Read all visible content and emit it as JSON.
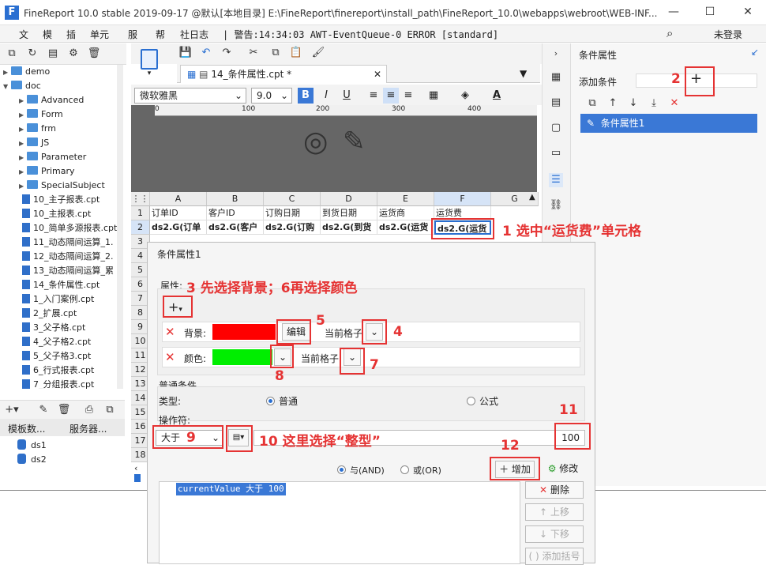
{
  "window": {
    "title": "FineReport 10.0 stable 2019-09-17 @默认[本地目录]   E:\\FineReport\\finereport\\install_path\\FineReport_10.0\\webapps\\webroot\\WEB-INF...",
    "min": "—",
    "max": "☐",
    "close": "✕"
  },
  "menu": {
    "items": [
      "文",
      "模",
      "插",
      "单元",
      "服",
      "帮",
      "社日志"
    ],
    "status": "| 警告:14:34:03 AWT-EventQueue-0 ERROR [standard]",
    "login": "未登录"
  },
  "tree": {
    "folders": [
      {
        "label": "demo"
      },
      {
        "label": "doc"
      },
      {
        "label": "Advanced"
      },
      {
        "label": "Form"
      },
      {
        "label": "frm"
      },
      {
        "label": "JS"
      },
      {
        "label": "Parameter"
      },
      {
        "label": "Primary"
      },
      {
        "label": "SpecialSubject"
      }
    ],
    "files": [
      "10_主子报表.cpt",
      "10_主报表.cpt",
      "10_简单多源报表.cpt",
      "11_动态隔间运算_1.",
      "12_动态隔间运算_2.",
      "13_动态隔间运算_累",
      "14_条件属性.cpt",
      "1_入门案例.cpt",
      "2_扩展.cpt",
      "3_父子格.cpt",
      "4_父子格2.cpt",
      "5_父子格3.cpt",
      "6_行式报表.cpt",
      "7_分组报表.cpt"
    ]
  },
  "panel_tabs": {
    "template_data": "模板数...",
    "server": "服务器..."
  },
  "datasets": [
    "ds1",
    "ds2"
  ],
  "editor": {
    "tab_label": "14_条件属性.cpt *",
    "font": "微软雅黑",
    "size": "9.0",
    "bold": "B",
    "italic": "I",
    "underline": "U",
    "ruler": [
      "0",
      "100",
      "200",
      "300",
      "400"
    ]
  },
  "sheet": {
    "cols": [
      "A",
      "B",
      "C",
      "D",
      "E",
      "F",
      "G"
    ],
    "rows": [
      "1",
      "2",
      "3",
      "4",
      "5",
      "6",
      "7",
      "8",
      "9",
      "10",
      "11",
      "12",
      "13",
      "14",
      "15",
      "16",
      "17",
      "18"
    ],
    "header_row": [
      "订单ID",
      "客户ID",
      "订购日期",
      "到货日期",
      "运货商",
      "运货费"
    ],
    "data_row": [
      "ds2.G(订单",
      "ds2.G(客户",
      "ds2.G(订购",
      "ds2.G(到货",
      "ds2.G(运货",
      "ds2.G(运货"
    ]
  },
  "right_panel": {
    "title": "条件属性",
    "add_label": "添加条件",
    "add_btn": "+",
    "item": "条件属性1"
  },
  "dialog": {
    "title": "条件属性1",
    "attr_label": "属性:",
    "bg_label": "背景:",
    "edit_btn": "编辑",
    "scope1": "当前格子",
    "color_label": "颜色:",
    "scope2": "当前格子",
    "cond_title": "普通条件",
    "type_label": "类型:",
    "normal": "普通",
    "formula": "公式",
    "op_label": "操作符:",
    "op_value": "大于",
    "value": "100",
    "and": "与(AND)",
    "or": "或(OR)",
    "add": "增加",
    "modify": "修改",
    "condition": "currentValue 大于 100",
    "delete": "删除",
    "up": "上移",
    "down": "下移",
    "bracket": "添加括号",
    "bg_color": "#ff0000",
    "fg_color": "#00ee00"
  },
  "annotations": {
    "a1": "1 选中“运货费”单元格",
    "a2": "2",
    "a3": "3 先选择背景；6再选择颜色",
    "a4": "4",
    "a5": "5",
    "a7": "7",
    "a8": "8",
    "a9": "9",
    "a10": "10 这里选择“整型”",
    "a11": "11",
    "a12": "12"
  }
}
